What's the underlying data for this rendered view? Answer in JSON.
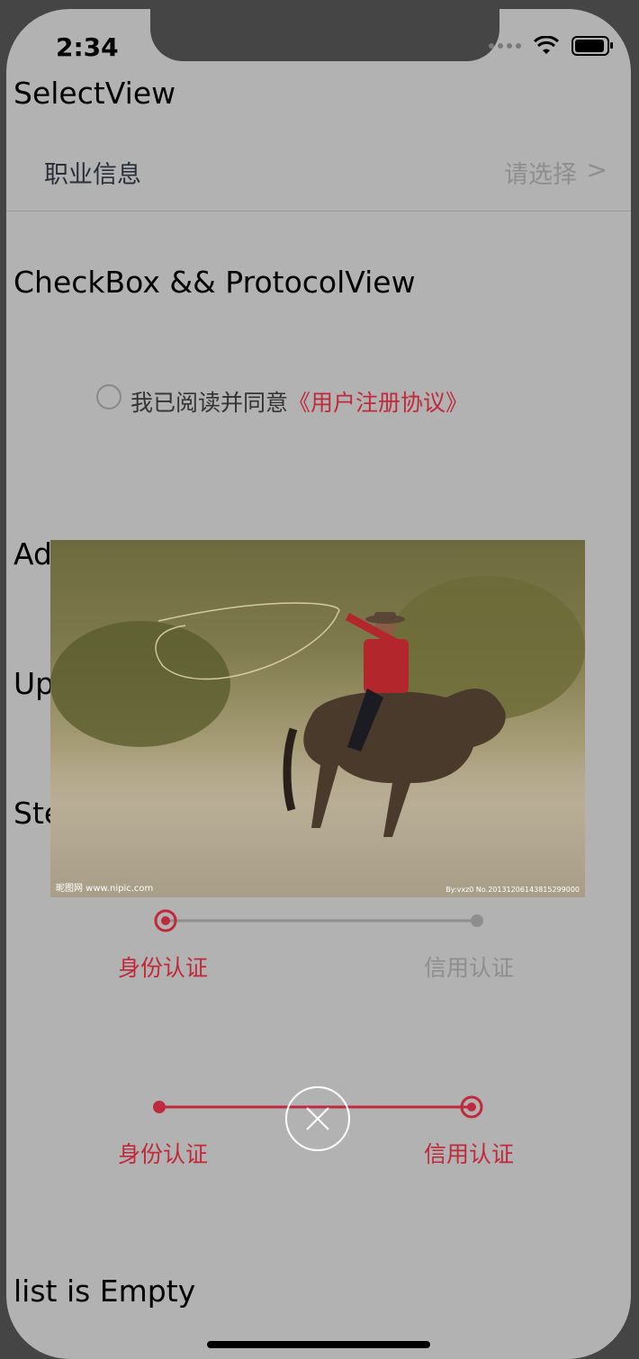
{
  "status_bar": {
    "time": "2:34"
  },
  "sections": {
    "select_view": "SelectView",
    "checkbox_protocol": "CheckBox && ProtocolView",
    "partial_1": "Ad",
    "partial_2": "Up",
    "partial_3": "Ste",
    "list_empty": "list is Empty"
  },
  "select_row": {
    "label": "职业信息",
    "value": "请选择",
    "chevron": ">"
  },
  "protocol": {
    "prefix": "我已阅读并同意",
    "link": "《用户注册协议》"
  },
  "photo": {
    "watermark_left": "昵图网 www.nipic.com",
    "watermark_right": "By:vxz0  No.20131206143815299000"
  },
  "steps_1": {
    "step1": "身份认证",
    "step2": "信用认证"
  },
  "steps_2": {
    "step1": "身份认证",
    "step2": "信用认证"
  },
  "colors": {
    "accent": "#c0293b",
    "overlay_bg": "#b2b2b2",
    "inactive": "#8e8e8e"
  },
  "icons": {
    "close": "close-icon",
    "wifi": "wifi-icon",
    "battery": "battery-icon",
    "chevron": "chevron-right-icon"
  }
}
